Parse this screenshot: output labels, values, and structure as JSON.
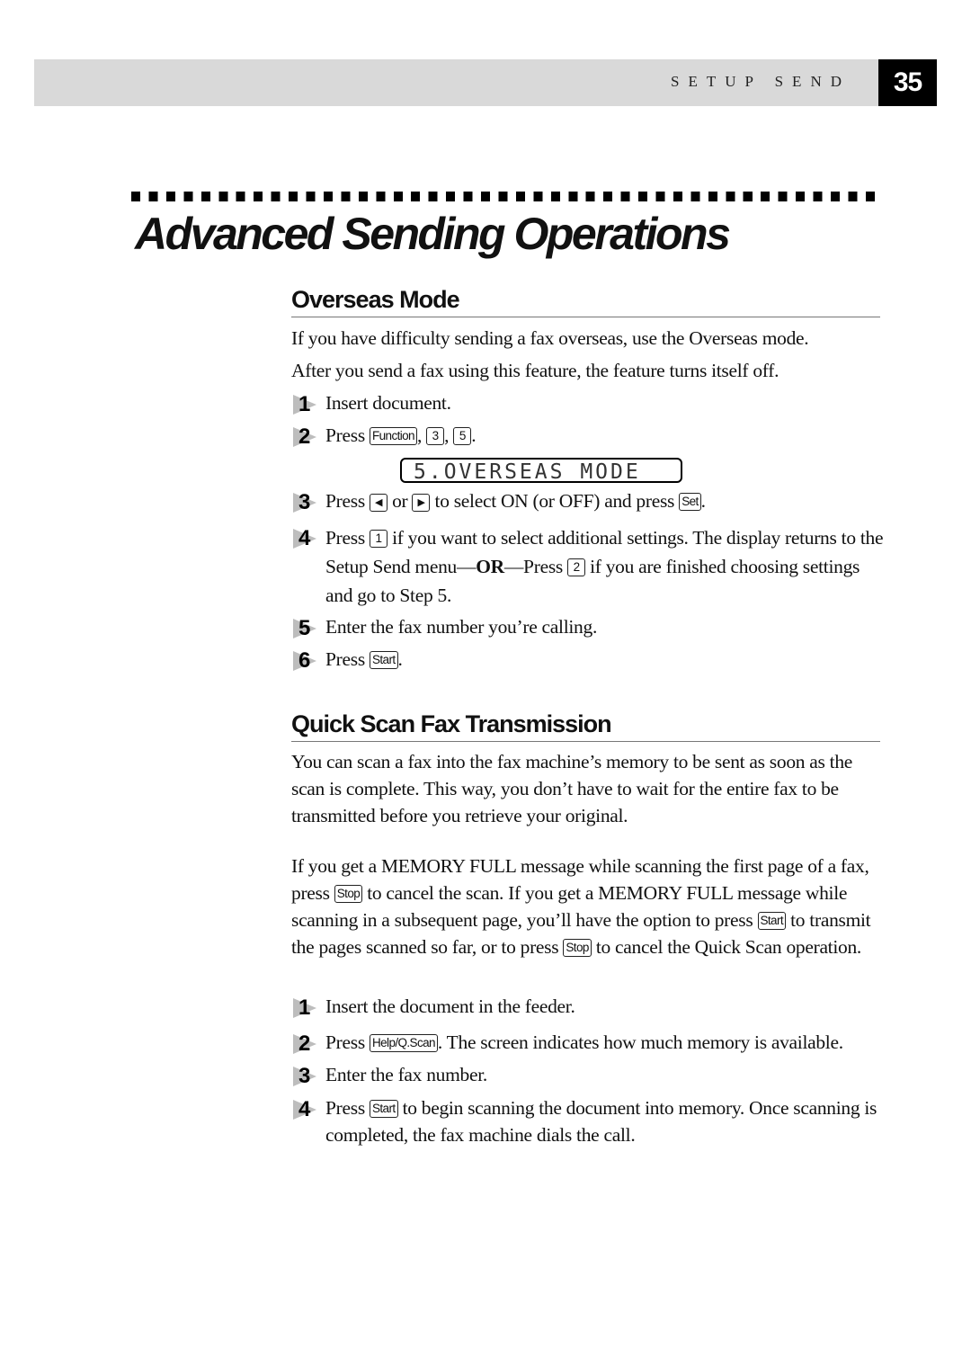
{
  "header": {
    "section_title": "SETUP SEND",
    "page_number": "35"
  },
  "title": "Advanced Sending Operations",
  "overseas": {
    "heading": "Overseas Mode",
    "intro": [
      "If you have difficulty sending a fax overseas, use the Overseas mode.",
      "After you send a fax using this feature, the feature turns itself off."
    ],
    "lcd_display": "5.OVERSEAS MODE",
    "steps": [
      {
        "num": "1",
        "text": "Insert document."
      },
      {
        "num": "2",
        "press": "Press",
        "keys": [
          "Function",
          "3",
          "5"
        ]
      },
      {
        "num": "3",
        "press": "Press",
        "key_left": "◀",
        "or": "or",
        "key_right": "▶",
        "mid": "to select ON (or OFF) and press",
        "key_set": "Set",
        "end": "."
      },
      {
        "num": "4",
        "press": "Press",
        "key1": "1",
        "text_a": "if you want to select additional settings. The display returns to the Setup Send menu—",
        "or_bold": "OR",
        "text_b": "—Press",
        "key2": "2",
        "text_c": "if you are finished choosing settings and go to Step 5."
      },
      {
        "num": "5",
        "text": "Enter the fax number you’re calling."
      },
      {
        "num": "6",
        "press": "Press",
        "key": "Start",
        "end": "."
      }
    ]
  },
  "quickscan": {
    "heading": "Quick Scan Fax Transmission",
    "para1": "You can scan a fax into the fax machine’s memory to be sent as soon as the scan is complete.  This way, you don’t have to wait for the entire fax to be transmitted before you retrieve your original.",
    "para2": {
      "a": "If you get a MEMORY FULL message while scanning the first page of a fax, press",
      "key_stop": "Stop",
      "b": "to cancel the scan.  If you get a MEMORY FULL message while scanning in a subsequent page, you’ll have the option to press",
      "key_start": "Start",
      "c": "to transmit the pages scanned so far, or to press",
      "d": "to cancel the Quick Scan operation."
    },
    "steps": [
      {
        "num": "1",
        "text": "Insert the document in the feeder."
      },
      {
        "num": "2",
        "press": "Press",
        "key": "Help/Q.Scan",
        "text": ".  The screen indicates how much memory is available."
      },
      {
        "num": "3",
        "text": "Enter the fax number."
      },
      {
        "num": "4",
        "press": "Press",
        "key": "Start",
        "text": "to begin scanning the document into memory.  Once scanning is completed, the fax machine dials the call."
      }
    ]
  }
}
